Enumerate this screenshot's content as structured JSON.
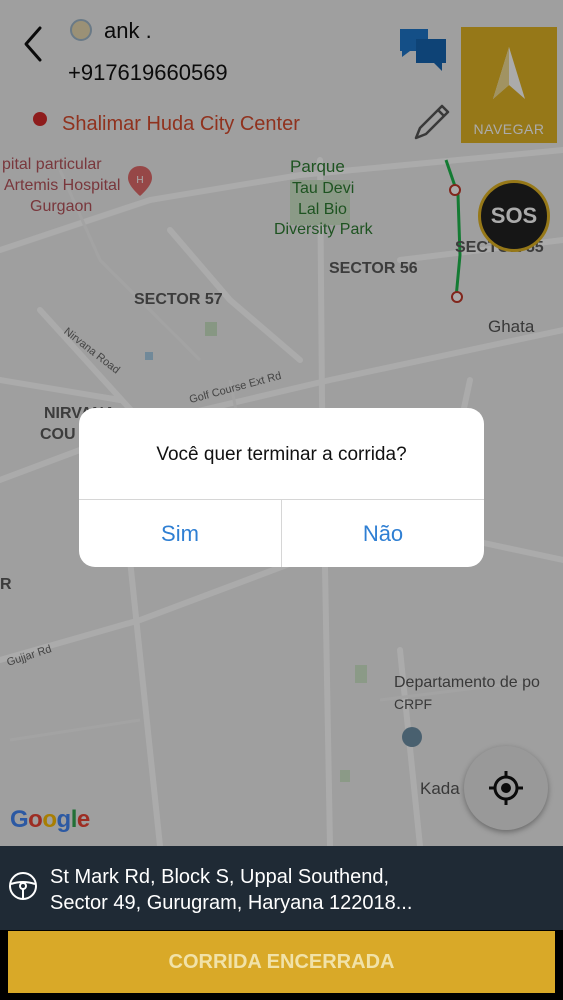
{
  "header": {
    "driver_name": "ank .",
    "phone": "+917619660569",
    "destination": "Shalimar Huda City Center",
    "navigate_label": "NAVEGAR",
    "sos_label": "SOS"
  },
  "map": {
    "labels": {
      "hospital_line1": "pital particular",
      "hospital_line2": "Artemis Hospital",
      "hospital_line3": "Gurgaon",
      "park_line1": "Parque",
      "park_line2": "Tau Devi",
      "park_line3": "Lal Bio",
      "park_line4": "Diversity Park",
      "sector56": "SECTOR 56",
      "sector57": "SECTOR 57",
      "sector55": "SECTOR 55",
      "ghata": "Ghata",
      "nirvana_line1": "NIRVANA",
      "nirvana_line2": "COU",
      "nirvana_road": "Nirvana Road",
      "course_road": "Golf Course Ext Rd",
      "r_label": "R",
      "gujjar_road": "Gujjar Rd",
      "crpf_line1": "Departamento de po",
      "crpf_line2": "CRPF",
      "kada": "Kada",
      "google": "Google"
    }
  },
  "dialog": {
    "message": "Você quer terminar a corrida?",
    "yes_label": "Sim",
    "no_label": "Não"
  },
  "bottom": {
    "address_line1": "St Mark Rd, Block S, Uppal Southend,",
    "address_line2": "Sector 49, Gurugram, Haryana 122018...",
    "finish_label": "CORRIDA ENCERRADA"
  },
  "colors": {
    "accent": "#e0b425",
    "destination_dot": "#d42a2a",
    "bottom_bar": "#1f2a35",
    "dialog_button": "#2f7fd3"
  }
}
